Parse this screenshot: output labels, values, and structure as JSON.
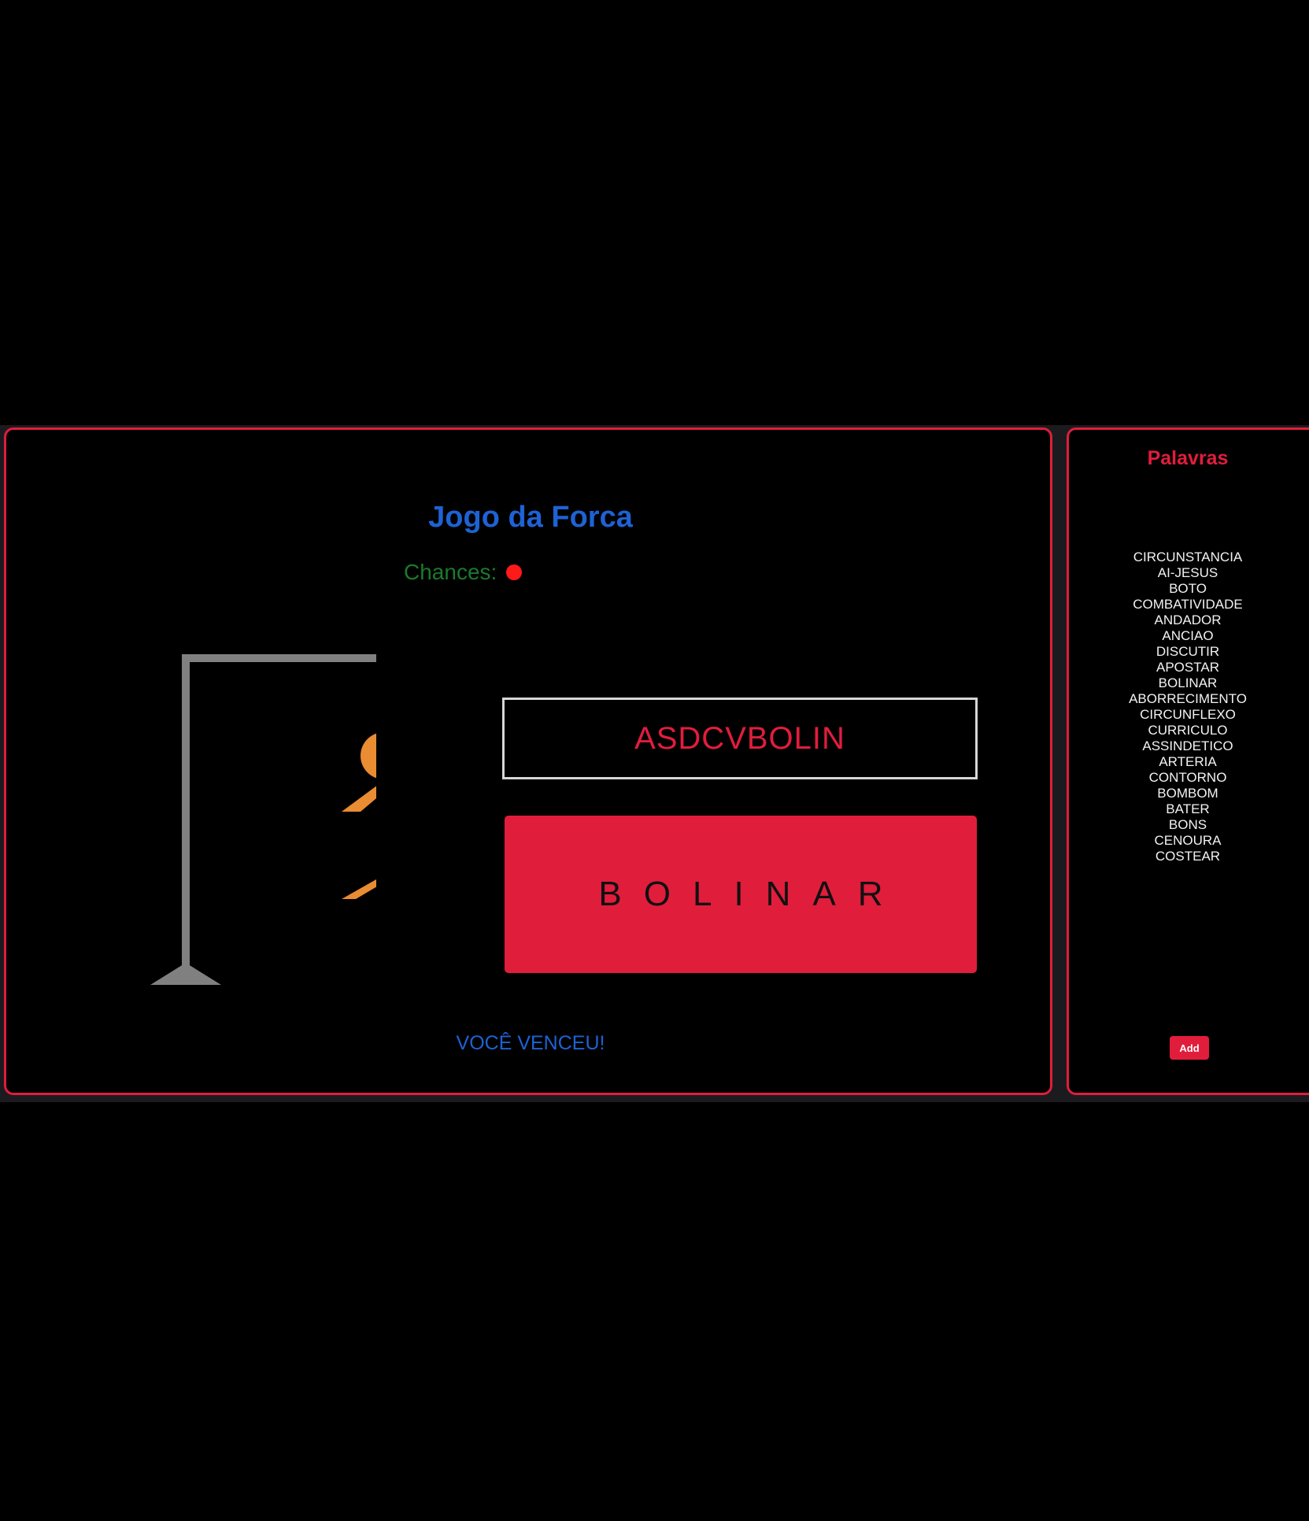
{
  "game": {
    "title": "Jogo da Forca",
    "chances_label": "Chances:",
    "chances_remaining": 1,
    "chance_dot_color": "#ff1a1a",
    "guessed_letters": "ASDCVBOLIN",
    "revealed_word": "BOLINAR",
    "result_message": "VOCÊ VENCEU!",
    "gallows_color": "#808080",
    "figure_color": "#e98c32"
  },
  "word_panel": {
    "title": "Palavras",
    "words": [
      "CIRCUNSTANCIA",
      "AI-JESUS",
      "BOTO",
      "COMBATIVIDADE",
      "ANDADOR",
      "ANCIAO",
      "DISCUTIR",
      "APOSTAR",
      "BOLINAR",
      "ABORRECIMENTO",
      "CIRCUNFLEXO",
      "CURRICULO",
      "ASSINDETICO",
      "ARTERIA",
      "CONTORNO",
      "BOMBOM",
      "BATER",
      "BONS",
      "CENOURA",
      "COSTEAR"
    ],
    "add_label": "Add"
  },
  "colors": {
    "accent": "#e11d3c",
    "title_blue": "#1e62d4",
    "chances_green": "#1b7a2b",
    "background": "#000000"
  }
}
